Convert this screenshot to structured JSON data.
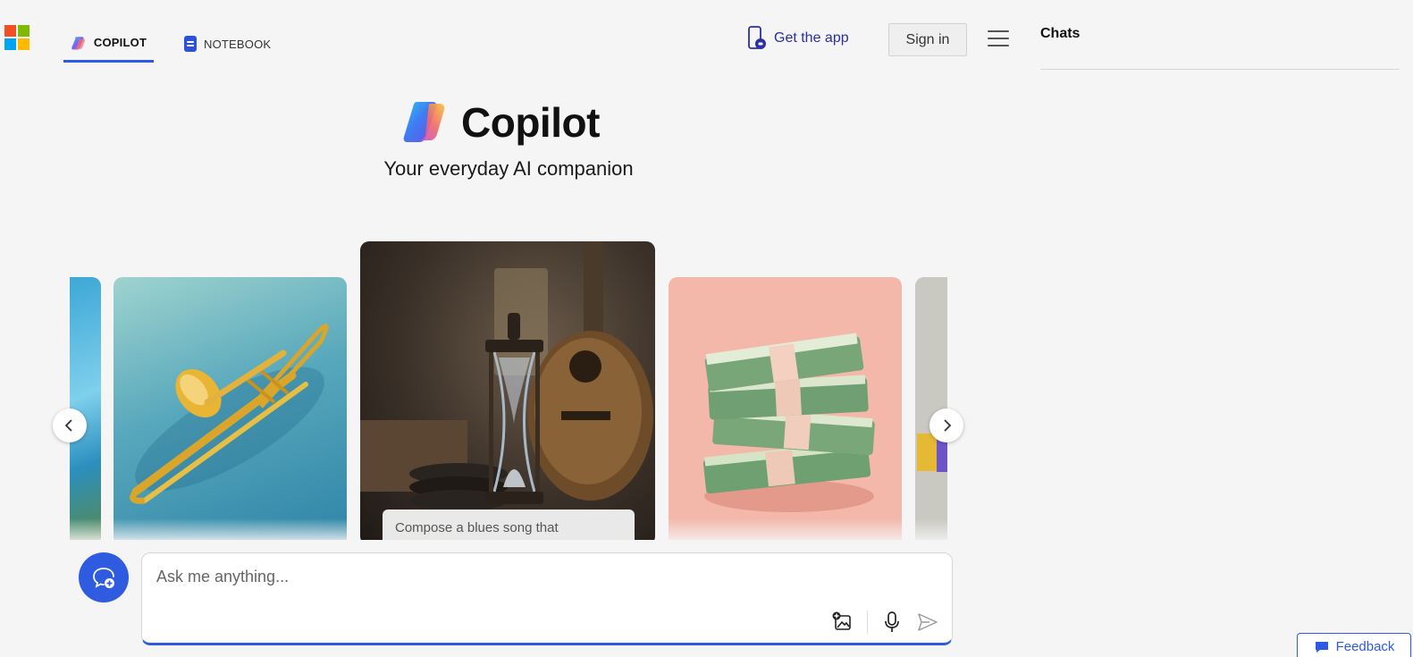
{
  "header": {
    "tabs": [
      {
        "label": "COPILOT",
        "active": true
      },
      {
        "label": "NOTEBOOK",
        "active": false
      }
    ],
    "get_app_label": "Get the app",
    "sign_in_label": "Sign in",
    "menu_icon": "hamburger-icon"
  },
  "sidebar": {
    "title": "Chats"
  },
  "hero": {
    "title": "Copilot",
    "subtitle": "Your everyday AI companion"
  },
  "carousel": {
    "cards": [
      "ocean-coast-image",
      "trombone-image",
      "hourglass-guitar-image",
      "money-stacks-image",
      "cube-image"
    ],
    "prompt_chip": "Compose a blues song that"
  },
  "composer": {
    "placeholder": "Ask me anything...",
    "tools": [
      "image-upload-icon",
      "microphone-icon",
      "send-icon"
    ]
  },
  "feedback_label": "Feedback",
  "colors": {
    "accent": "#2d5be3",
    "link": "#2a2fa8",
    "background": "#f5f5f5"
  }
}
